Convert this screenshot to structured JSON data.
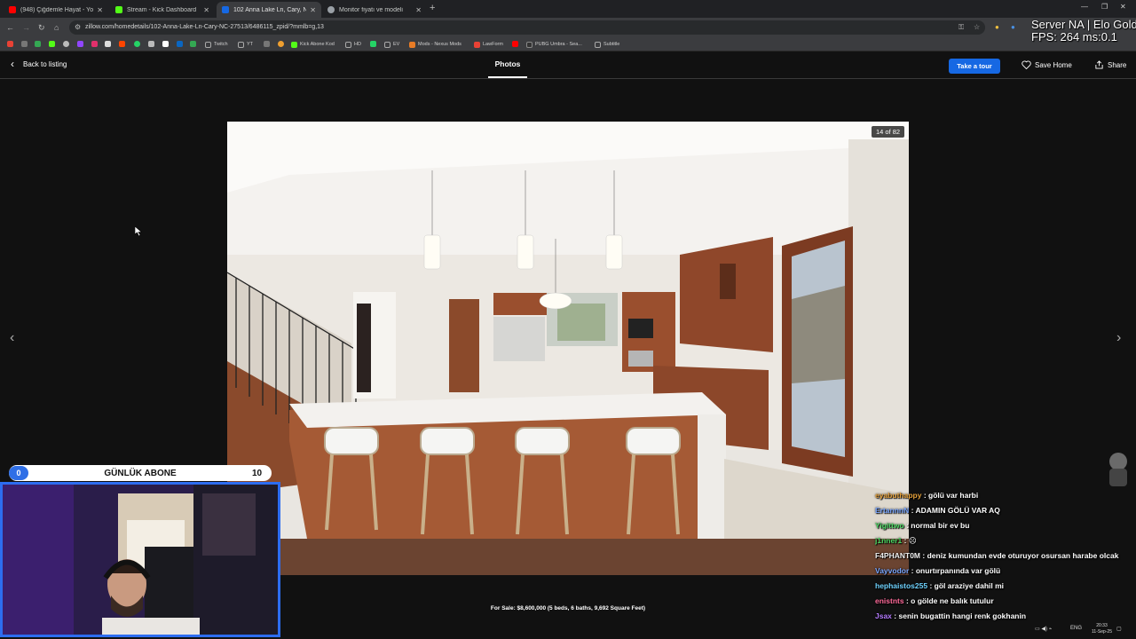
{
  "browser": {
    "tabs": [
      {
        "title": "(948) Çiğdemle Hayat - YouTube",
        "color": "#ff0000",
        "active": false
      },
      {
        "title": "Stream - Kick Dashboard",
        "color": "#53fc18",
        "active": false
      },
      {
        "title": "102 Anna Lake Ln, Cary, NC 275",
        "color": "#1668e3",
        "active": true
      },
      {
        "title": "Monitor fiyatı ve modeli",
        "color": "#9aa0a6",
        "active": false
      }
    ],
    "new_tab": "+",
    "url": "zillow.com/homedetails/102-Anna-Lake-Ln-Cary-NC-27513/6486115_zpid/?mmlb=g,13",
    "bookmarks": [
      "Twitch",
      "YT",
      "Kick Abone Kod",
      "HD",
      "EV",
      "Mods - Nexus Mods",
      "LawForm",
      "PUBG Umbra - Sea...",
      "Subtitle"
    ],
    "bookmark_icon_colors": [
      "#e94235",
      "#fbbc04",
      "#53fc18",
      "#9146ff",
      "#ffffff",
      "#ff0000",
      "#25d366",
      "#e1306c",
      "#0a66c2",
      "#34a853",
      "#5865f2",
      "#ff9900"
    ]
  },
  "overlay": {
    "server_line": "Server NA | Elo Gold",
    "fps_line": "FPS: 264 ms:0.1"
  },
  "viewer": {
    "back_label": "Back to listing",
    "photos_label": "Photos",
    "tour_label": "Take a tour",
    "save_label": "Save Home",
    "share_label": "Share",
    "counter": "14 of 82",
    "caption": "For Sale: $8,600,000 (5 beds, 6 baths, 9,692 Square Feet)"
  },
  "goal": {
    "label": "GÜNLÜK ABONE",
    "current": "0",
    "target": "10",
    "progress": 0
  },
  "chat": [
    {
      "user": "eyabuthappy",
      "color": "#e6a23c",
      "text": ": gölü var harbi"
    },
    {
      "user": "ErtannnN",
      "color": "#7aa7ff",
      "text": ": ADAMIN GÖLÜ VAR AQ"
    },
    {
      "user": "Yigittwo",
      "color": "#4cd964",
      "text": ": normal bir ev bu"
    },
    {
      "user": "j1nner1",
      "color": "#4cd964",
      "text": ":"
    },
    {
      "user": "F4PHANT0M",
      "color": "#f0f0f0",
      "text": ": deniz kumundan evde oturuyor osursan harabe olcak"
    },
    {
      "user": "Vayvodor",
      "color": "#7aa7ff",
      "text": ": onurtırpanında var gölü"
    },
    {
      "user": "hephaistos255",
      "color": "#6fd3ff",
      "text": ": göl araziye dahil mi"
    },
    {
      "user": "enistnts",
      "color": "#ff6b9a",
      "text": ": o gölde ne balık tutulur"
    },
    {
      "user": "Jsax",
      "color": "#b57cff",
      "text": ": senin bugattin hangi renk gokhanin"
    }
  ],
  "tray": {
    "lang": "ENG",
    "time": "20:33",
    "date": "11-Sep-25"
  }
}
